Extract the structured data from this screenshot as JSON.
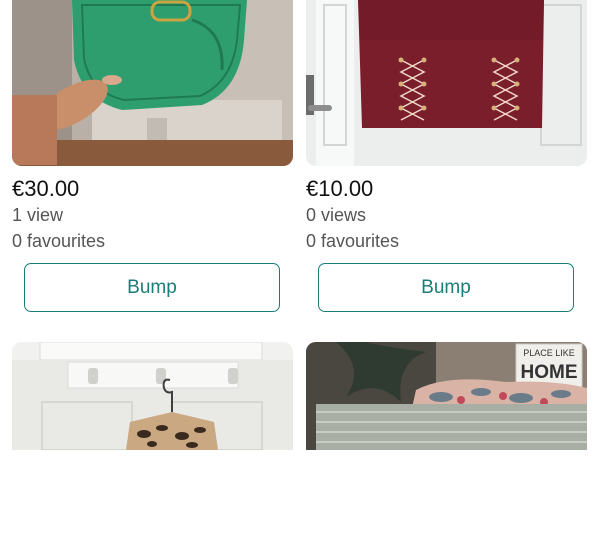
{
  "listings": [
    {
      "price": "€30.00",
      "views": "1 view",
      "favourites": "0 favourites",
      "button": "Bump"
    },
    {
      "price": "€10.00",
      "views": "0 views",
      "favourites": "0 favourites",
      "button": "Bump"
    },
    {
      "price": "",
      "views": "",
      "favourites": "",
      "button": ""
    },
    {
      "price": "",
      "views": "",
      "favourites": "",
      "button": ""
    }
  ],
  "photo_signs": {
    "wall_sign_line1": "PLACE LIKE",
    "wall_sign_line2": "HOME"
  },
  "colors": {
    "accent": "#1b7d7a",
    "bag": "#2f9e6e",
    "skirt": "#7a1e2c"
  }
}
